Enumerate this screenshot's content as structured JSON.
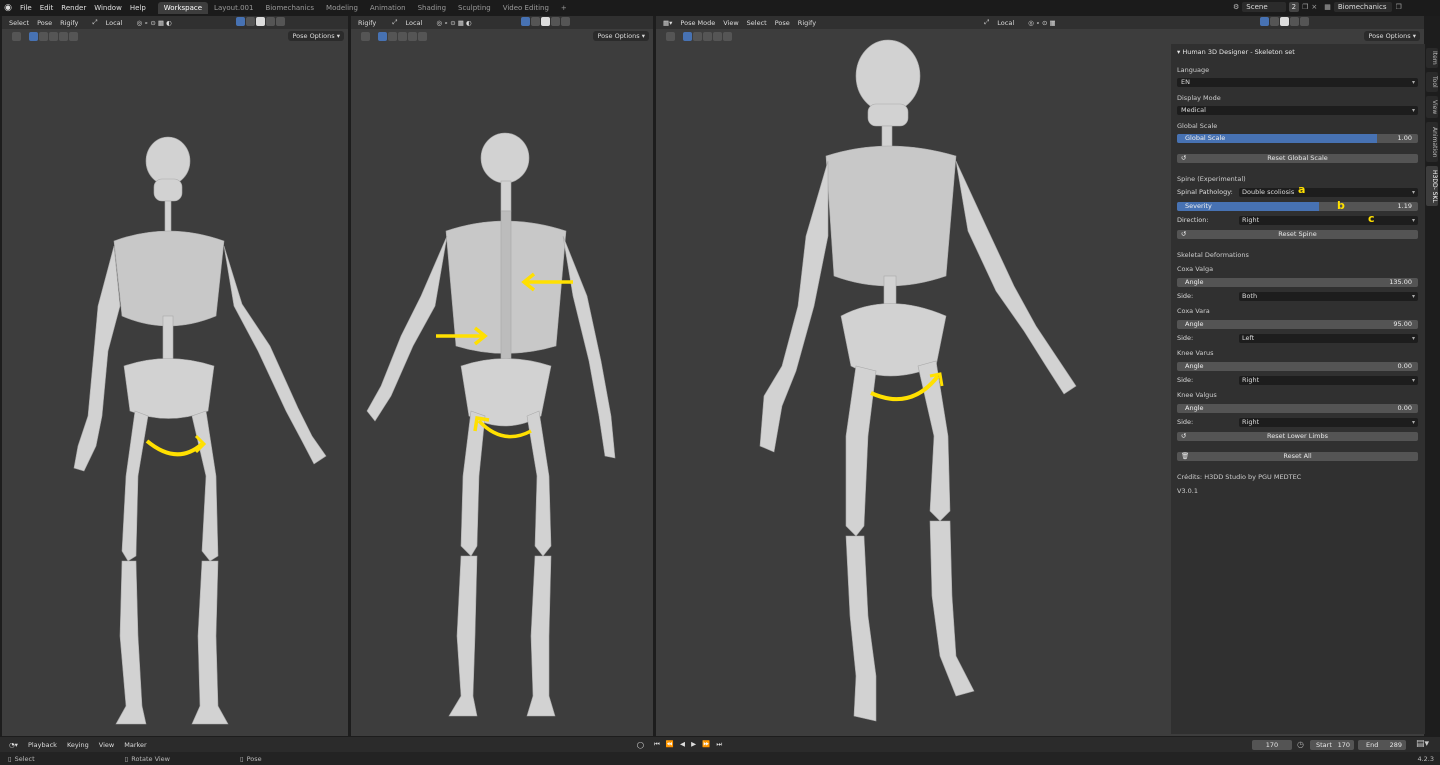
{
  "topbar": {
    "menus": [
      "File",
      "Edit",
      "Render",
      "Window",
      "Help"
    ],
    "workspaces": [
      "Workspace",
      "Layout.001",
      "Biomechanics",
      "Modeling",
      "Animation",
      "Shading",
      "Sculpting",
      "Video Editing"
    ],
    "add_tab": "+",
    "scene_label": "Scene",
    "scene_count": "2",
    "view_layer": "Biomechanics"
  },
  "viewport1": {
    "menus": [
      "Select",
      "Pose",
      "Rigify"
    ],
    "transform": "Local",
    "pose_options": "Pose Options"
  },
  "viewport2": {
    "menus": [
      "Rigify"
    ],
    "transform": "Local",
    "pose_options": "Pose Options"
  },
  "viewport3": {
    "mode": "Pose Mode",
    "menus": [
      "View",
      "Select",
      "Pose",
      "Rigify"
    ],
    "transform": "Local",
    "pose_options": "Pose Options"
  },
  "panel": {
    "title": "Human 3D Designer - Skeleton set",
    "language_label": "Language",
    "language_value": "EN",
    "display_mode_label": "Display Mode",
    "display_mode_value": "Medical",
    "global_scale_label": "Global Scale",
    "global_scale_slider": "Global Scale",
    "global_scale_value": "1.00",
    "global_scale_fraction": 0.83,
    "reset_global_scale": "Reset Global Scale",
    "spine_section": "Spine (Experimental)",
    "spinal_pathology_label": "Spinal Pathology:",
    "spinal_pathology_value": "Double scoliosis",
    "severity_label": "Severity",
    "severity_value": "1.19",
    "severity_fraction": 0.59,
    "direction_label": "Direction:",
    "direction_value": "Right",
    "reset_spine": "Reset Spine",
    "skeletal_section": "Skeletal Deformations",
    "coxa_valga": "Coxa Valga",
    "coxa_valga_angle_label": "Angle",
    "coxa_valga_angle": "135.00",
    "coxa_valga_side_label": "Side:",
    "coxa_valga_side": "Both",
    "coxa_vara": "Coxa Vara",
    "coxa_vara_angle_label": "Angle",
    "coxa_vara_angle": "95.00",
    "coxa_vara_side_label": "Side:",
    "coxa_vara_side": "Left",
    "knee_varus": "Knee Varus",
    "knee_varus_angle_label": "Angle",
    "knee_varus_angle": "0.00",
    "knee_varus_side_label": "Side:",
    "knee_varus_side": "Right",
    "knee_valgus": "Knee Valgus",
    "knee_valgus_angle_label": "Angle",
    "knee_valgus_angle": "0.00",
    "knee_valgus_side_label": "Side:",
    "knee_valgus_side": "Right",
    "reset_lower_limbs": "Reset Lower Limbs",
    "reset_all": "Reset All",
    "credits": "Crédits: H3DD Studio by PGU MEDTEC",
    "version": "V3.0.1",
    "annot_a": "a",
    "annot_b": "b",
    "annot_c": "c"
  },
  "side_tabs": [
    "Item",
    "Tool",
    "View",
    "Animation",
    "H3DD- SKL"
  ],
  "timeline": {
    "menus": [
      "Playback",
      "Keying",
      "View",
      "Marker"
    ],
    "current_frame": "170",
    "start_label": "Start",
    "start_value": "170",
    "end_label": "End",
    "end_value": "289"
  },
  "statusbar": {
    "select": "Select",
    "rotate_view": "Rotate View",
    "pose": "Pose",
    "version": "4.2.3"
  },
  "colors": {
    "viewport_bg": "#3d3d3d",
    "accent": "#4772b3",
    "annotation": "#ffe000",
    "bone": "#d2d2d2"
  }
}
